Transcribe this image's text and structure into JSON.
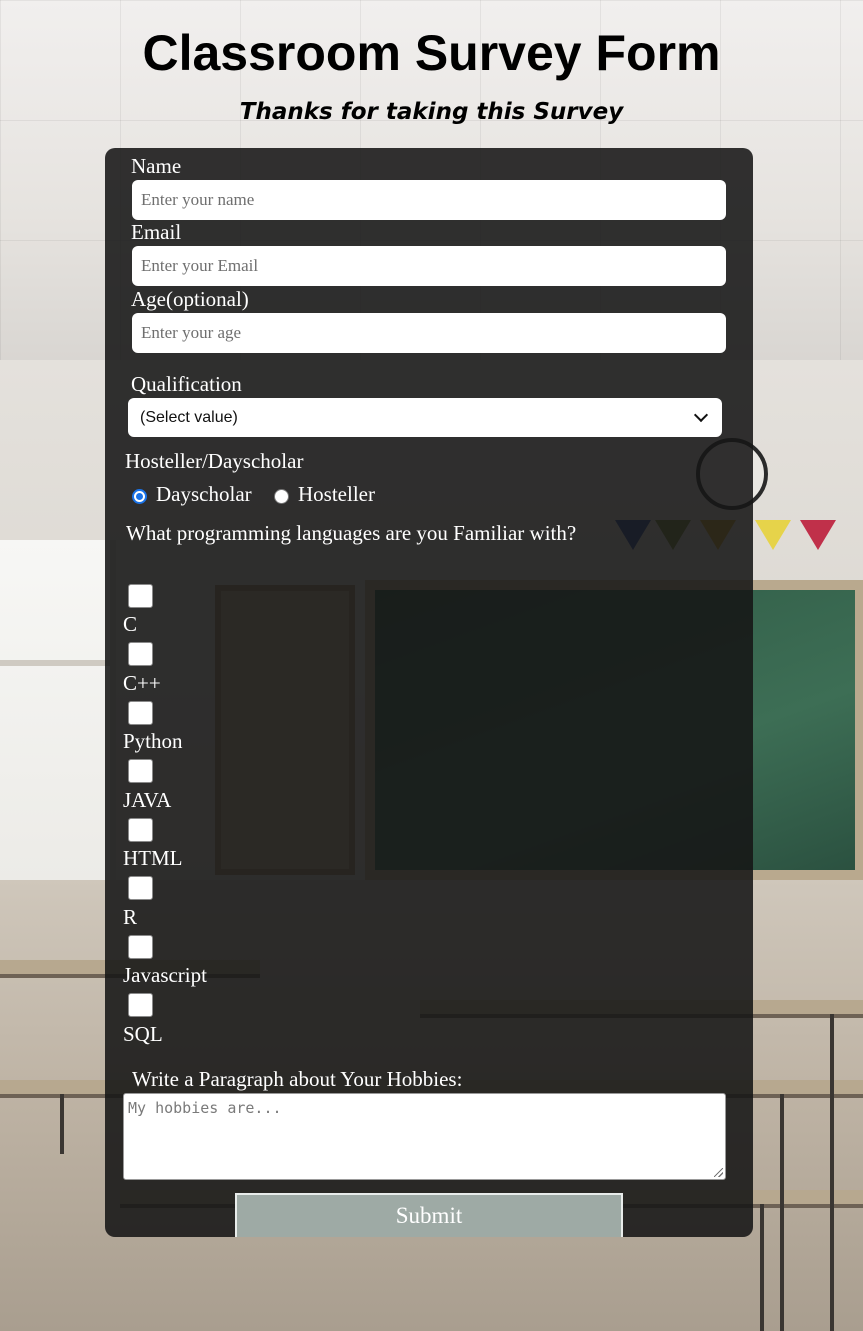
{
  "header": {
    "title": "Classroom Survey Form",
    "subtitle": "Thanks for taking this Survey"
  },
  "form": {
    "name": {
      "label": "Name",
      "placeholder": "Enter your name"
    },
    "email": {
      "label": "Email",
      "placeholder": "Enter your Email"
    },
    "age": {
      "label": "Age(optional)",
      "placeholder": "Enter your age"
    },
    "qualification": {
      "label": "Qualification",
      "selected": "(Select value)"
    },
    "residence": {
      "label": "Hosteller/Dayscholar",
      "options": [
        {
          "label": "Dayscholar",
          "checked": true
        },
        {
          "label": "Hosteller",
          "checked": false
        }
      ]
    },
    "languages": {
      "question": "What programming languages are you Familiar with?",
      "options": [
        "C",
        "C++",
        "Python",
        "JAVA",
        "HTML",
        "R",
        "Javascript",
        "SQL"
      ]
    },
    "hobbies": {
      "label": "Write a Paragraph about Your Hobbies:",
      "placeholder": "My hobbies are..."
    },
    "submit_label": "Submit"
  },
  "colors": {
    "card_bg": "#161616",
    "submit_bg": "#9eaaa5",
    "radio_accent": "#1a73e8"
  }
}
